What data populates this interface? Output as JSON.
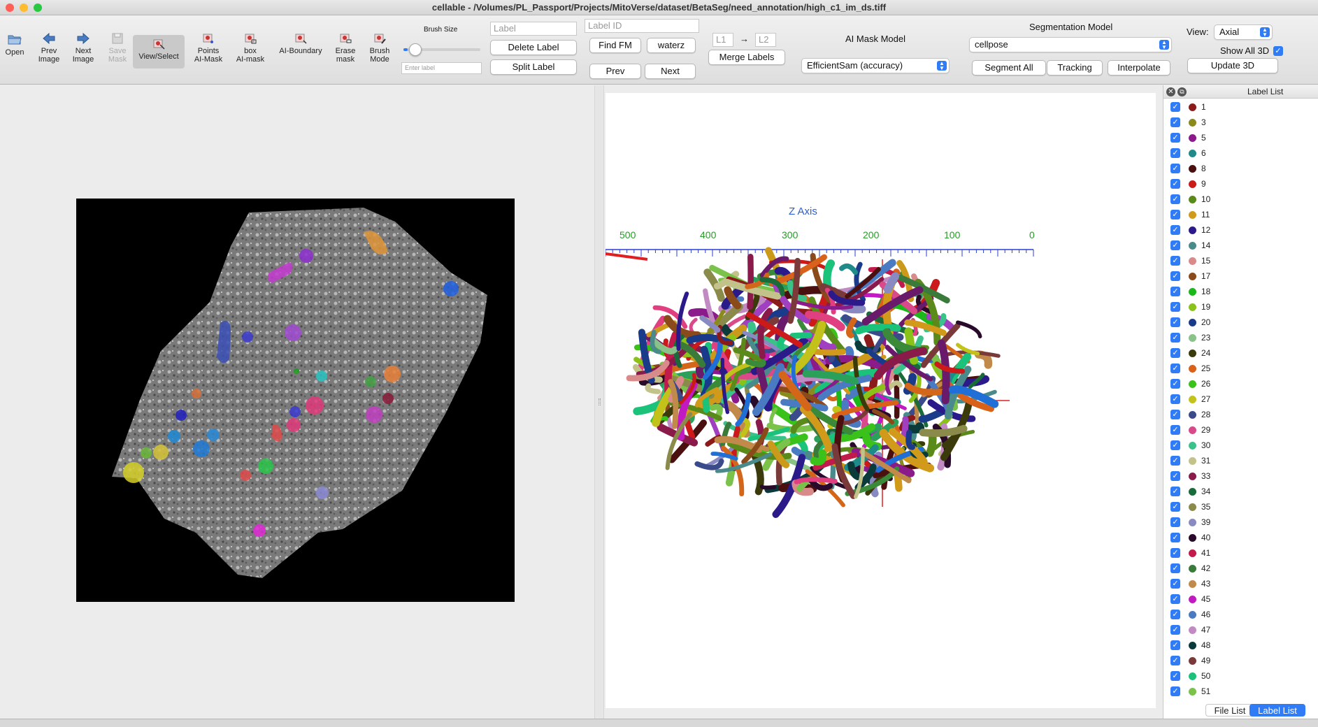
{
  "window": {
    "title": "cellable - /Volumes/PL_Passport/Projects/MitoVerse/dataset/BetaSeg/need_annotation/high_c1_im_ds.tiff"
  },
  "toolbar": {
    "open": "Open",
    "prev_image": [
      "Prev",
      "Image"
    ],
    "next_image": [
      "Next",
      "Image"
    ],
    "save_mask": [
      "Save",
      "Mask"
    ],
    "view_select": "View/Select",
    "points_ai_mask": [
      "Points",
      "AI-Mask"
    ],
    "box_ai_mask": [
      "box",
      "AI-mask"
    ],
    "ai_boundary": "AI-Boundary",
    "erase_mask": [
      "Erase",
      "mask"
    ],
    "brush_mode": [
      "Brush",
      "Mode"
    ],
    "brush_size_label": "Brush Size",
    "brush_size_value": 0.05,
    "enter_label_placeholder": "Enter label",
    "label_placeholder": "Label",
    "label_id_placeholder": "Label ID",
    "delete_label": "Delete Label",
    "split_label": "Split Label",
    "find_fm": "Find FM",
    "waterz": "waterz",
    "prev": "Prev",
    "next": "Next",
    "l1_placeholder": "L1",
    "arrow": "→",
    "l2_placeholder": "L2",
    "merge_labels": "Merge Labels",
    "ai_mask_model_label": "AI Mask Model",
    "ai_mask_model_value": "EfficientSam (accuracy)",
    "segmentation_model_label": "Segmentation Model",
    "segmentation_model_value": "cellpose",
    "segment_all": "Segment All",
    "tracking": "Tracking",
    "interpolate": "Interpolate",
    "view_label": "View:",
    "view_value": "Axial",
    "show_all_3d": "Show All 3D",
    "update_3d": "Update 3D"
  },
  "viewer3d": {
    "axis_title": "Z Axis",
    "ticks": [
      "500",
      "400",
      "300",
      "200",
      "100",
      "0"
    ]
  },
  "panel": {
    "title": "Label List",
    "labels": [
      {
        "id": "1",
        "color": "#8b1a1a"
      },
      {
        "id": "3",
        "color": "#8a8a1f"
      },
      {
        "id": "5",
        "color": "#8b1a8b"
      },
      {
        "id": "6",
        "color": "#1f8a8a"
      },
      {
        "id": "8",
        "color": "#4a1010"
      },
      {
        "id": "9",
        "color": "#cc1a1a"
      },
      {
        "id": "10",
        "color": "#5a8a1a"
      },
      {
        "id": "11",
        "color": "#d19a1a"
      },
      {
        "id": "12",
        "color": "#2a1a8a"
      },
      {
        "id": "14",
        "color": "#4a8a8a"
      },
      {
        "id": "15",
        "color": "#d98a8a"
      },
      {
        "id": "17",
        "color": "#8a4a1a"
      },
      {
        "id": "18",
        "color": "#1ab81a"
      },
      {
        "id": "19",
        "color": "#8ac21a"
      },
      {
        "id": "20",
        "color": "#1a3a8a"
      },
      {
        "id": "23",
        "color": "#8ac28a"
      },
      {
        "id": "24",
        "color": "#3a3a0a"
      },
      {
        "id": "25",
        "color": "#d9621a"
      },
      {
        "id": "26",
        "color": "#3ac21a"
      },
      {
        "id": "27",
        "color": "#c2c21a"
      },
      {
        "id": "28",
        "color": "#3a4a8a"
      },
      {
        "id": "29",
        "color": "#d94a8a"
      },
      {
        "id": "30",
        "color": "#3ac28a"
      },
      {
        "id": "31",
        "color": "#c2c28a"
      },
      {
        "id": "33",
        "color": "#8a1a4a"
      },
      {
        "id": "34",
        "color": "#1a6a3a"
      },
      {
        "id": "35",
        "color": "#8a8a4a"
      },
      {
        "id": "39",
        "color": "#8a8ac2"
      },
      {
        "id": "40",
        "color": "#2a0a2a"
      },
      {
        "id": "41",
        "color": "#c21a4a"
      },
      {
        "id": "42",
        "color": "#3a7a3a"
      },
      {
        "id": "43",
        "color": "#c28a4a"
      },
      {
        "id": "45",
        "color": "#c21ac2"
      },
      {
        "id": "46",
        "color": "#4a7ac2"
      },
      {
        "id": "47",
        "color": "#c28ac2"
      },
      {
        "id": "48",
        "color": "#0a3a3a"
      },
      {
        "id": "49",
        "color": "#7a3a3a"
      },
      {
        "id": "50",
        "color": "#1ac27a"
      },
      {
        "id": "51",
        "color": "#7ac24a"
      }
    ],
    "file_list_tab": "File List",
    "label_list_tab": "Label List"
  }
}
